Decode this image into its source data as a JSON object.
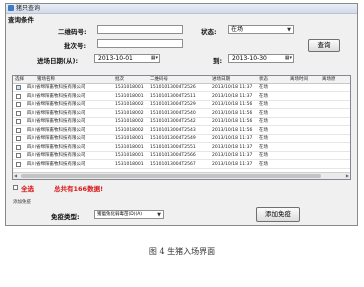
{
  "window": {
    "title": "猪只查询"
  },
  "query": {
    "section_title": "查询条件",
    "ear_label": "二维码号:",
    "ear_value": "",
    "batch_label": "批次号:",
    "batch_value": "",
    "date_label": "进场日期(从):",
    "date_from": "2013-10-01",
    "to_label": "到:",
    "date_to": "2013-10-30",
    "status_label": "状态:",
    "status_value": "在场",
    "search_button": "查询"
  },
  "grid": {
    "columns": [
      "选择",
      "猪场名称",
      "批次",
      "二维码号",
      "进场日期",
      "状态",
      "离场时间",
      "离场原"
    ],
    "rows": [
      {
        "farm": "四川省绵阳畜牧科技有限公司",
        "batch": "1531018001",
        "code": "15101013004T2526",
        "date": "2013/10/18 11:37",
        "status": "在场"
      },
      {
        "farm": "四川省绵阳畜牧科技有限公司",
        "batch": "1531018001",
        "code": "15101013004T2511",
        "date": "2013/10/18 11:37",
        "status": "在场"
      },
      {
        "farm": "四川省绵阳畜牧科技有限公司",
        "batch": "1531018002",
        "code": "15101013004T2529",
        "date": "2013/10/18 11:56",
        "status": "在场"
      },
      {
        "farm": "四川省绵阳畜牧科技有限公司",
        "batch": "1531018002",
        "code": "15101013004T2540",
        "date": "2013/10/18 11:56",
        "status": "在场"
      },
      {
        "farm": "四川省绵阳畜牧科技有限公司",
        "batch": "1531018002",
        "code": "15101013004T2542",
        "date": "2013/10/18 11:56",
        "status": "在场"
      },
      {
        "farm": "四川省绵阳畜牧科技有限公司",
        "batch": "1531018002",
        "code": "15101013004T2543",
        "date": "2013/10/18 11:56",
        "status": "在场"
      },
      {
        "farm": "四川省绵阳畜牧科技有限公司",
        "batch": "1531018001",
        "code": "15101013004T2549",
        "date": "2013/10/18 11:37",
        "status": "在场"
      },
      {
        "farm": "四川省绵阳畜牧科技有限公司",
        "batch": "1531018001",
        "code": "15101013004T2551",
        "date": "2013/10/18 11:37",
        "status": "在场"
      },
      {
        "farm": "四川省绵阳畜牧科技有限公司",
        "batch": "1531018001",
        "code": "15101013004T2566",
        "date": "2013/10/18 11:37",
        "status": "在场"
      },
      {
        "farm": "四川省绵阳畜牧科技有限公司",
        "batch": "1531018001",
        "code": "15101013004T2567",
        "date": "2013/10/18 11:37",
        "status": "在场"
      }
    ]
  },
  "footer": {
    "select_all_label": "全选",
    "total_text": "总共有166数据!",
    "add_section": "添加免疫",
    "type_label": "免疫类型:",
    "type_value": "猪瘟兔化弱毒苗(D)(A)",
    "add_button": "添加免疫"
  },
  "caption": "图 4   生猪入场界面",
  "colors": {
    "accent_red": "#d81818",
    "title_icon": "#3a7cc8"
  }
}
